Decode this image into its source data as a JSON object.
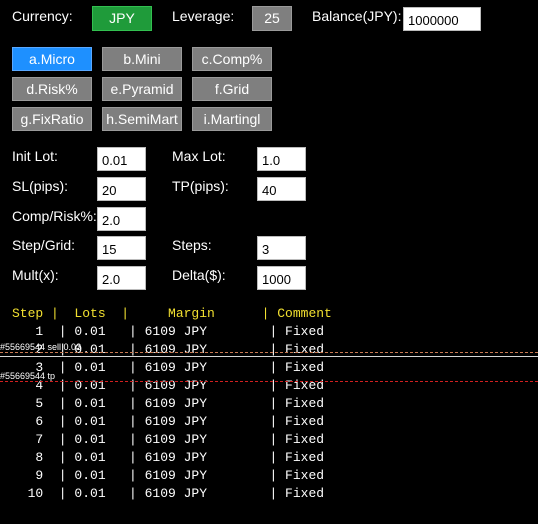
{
  "header": {
    "currency_label": "Currency:",
    "currency_value": "JPY",
    "leverage_label": "Leverage:",
    "leverage_value": "25",
    "balance_label": "Balance(JPY):",
    "balance_value": "1000000"
  },
  "modes": [
    {
      "label": "a.Micro",
      "active": true
    },
    {
      "label": "b.Mini",
      "active": false
    },
    {
      "label": "c.Comp%",
      "active": false
    },
    {
      "label": "d.Risk%",
      "active": false
    },
    {
      "label": "e.Pyramid",
      "active": false
    },
    {
      "label": "f.Grid",
      "active": false
    },
    {
      "label": "g.FixRatio",
      "active": false
    },
    {
      "label": "h.SemiMart",
      "active": false
    },
    {
      "label": "i.Martingl",
      "active": false
    }
  ],
  "params": {
    "init_lot_label": "Init Lot:",
    "init_lot": "0.01",
    "max_lot_label": "Max Lot:",
    "max_lot": "1.0",
    "sl_label": "SL(pips):",
    "sl": "20",
    "tp_label": "TP(pips):",
    "tp": "40",
    "comp_label": "Comp/Risk%:",
    "comp": "2.0",
    "grid_label": "Step/Grid:",
    "grid": "15",
    "steps_label": "Steps:",
    "steps": "3",
    "mult_label": "Mult(x):",
    "mult": "2.0",
    "delta_label": "Delta($):",
    "delta": "1000"
  },
  "table": {
    "header_line": "Step |  Lots  |     Margin      | Comment",
    "rows": [
      {
        "step": "1",
        "lots": "0.01",
        "margin": "6109 JPY",
        "comment": "Fixed"
      },
      {
        "step": "2",
        "lots": "0.01",
        "margin": "6109 JPY",
        "comment": "Fixed"
      },
      {
        "step": "3",
        "lots": "0.01",
        "margin": "6109 JPY",
        "comment": "Fixed"
      },
      {
        "step": "4",
        "lots": "0.01",
        "margin": "6109 JPY",
        "comment": "Fixed"
      },
      {
        "step": "5",
        "lots": "0.01",
        "margin": "6109 JPY",
        "comment": "Fixed"
      },
      {
        "step": "6",
        "lots": "0.01",
        "margin": "6109 JPY",
        "comment": "Fixed"
      },
      {
        "step": "7",
        "lots": "0.01",
        "margin": "6109 JPY",
        "comment": "Fixed"
      },
      {
        "step": "8",
        "lots": "0.01",
        "margin": "6109 JPY",
        "comment": "Fixed"
      },
      {
        "step": "9",
        "lots": "0.01",
        "margin": "6109 JPY",
        "comment": "Fixed"
      },
      {
        "step": "10",
        "lots": "0.01",
        "margin": "6109 JPY",
        "comment": "Fixed"
      }
    ]
  },
  "chart_lines": {
    "sell_tag": "#55669544 sell 0.03",
    "tp_tag": "#55669544 tp",
    "sell_color": "#c87850",
    "tp_color": "#d02020"
  }
}
